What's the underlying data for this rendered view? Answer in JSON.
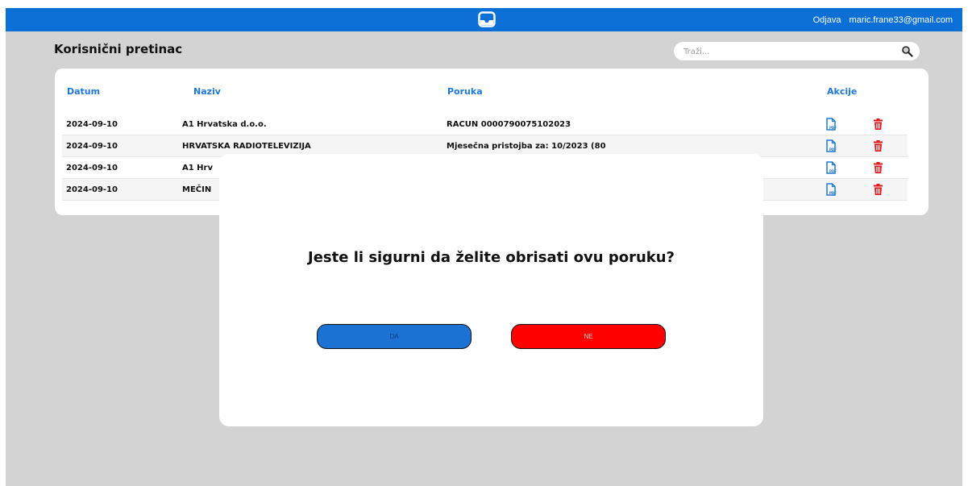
{
  "header": {
    "logout_label": "Odjava",
    "user_email": "maric.frane33@gmail.com",
    "logo_icon": "inbox-tray-icon",
    "bar_color": "#0b6fd6"
  },
  "page": {
    "title": "Korisnični pretinac"
  },
  "search": {
    "placeholder": "Traži...",
    "icon": "search-icon"
  },
  "table": {
    "columns": {
      "date": "Datum",
      "name": "Naziv",
      "message": "Poruka",
      "actions": "Akcije"
    },
    "rows": [
      {
        "date": "2024-09-10",
        "name": "A1 Hrvatska d.o.o.",
        "message": "RACUN 0000790075102023"
      },
      {
        "date": "2024-09-10",
        "name": "HRVATSKA RADIOTELEVIZIJA",
        "message": "Mjesečna pristojba za: 10/2023 (80"
      },
      {
        "date": "2024-09-10",
        "name": "A1 Hrv",
        "message": ""
      },
      {
        "date": "2024-09-10",
        "name": "MEČIN",
        "message": ""
      }
    ],
    "action_icons": [
      "pdf-file-icon",
      "trash-icon"
    ],
    "header_color": "#1f78d8",
    "delete_color": "#e0161c"
  },
  "modal": {
    "question": "Jeste li sigurni da želite obrisati ovu poruku?",
    "yes_label": "DA",
    "no_label": "NE",
    "yes_color": "#1b72d3",
    "no_color": "#ff0000"
  }
}
